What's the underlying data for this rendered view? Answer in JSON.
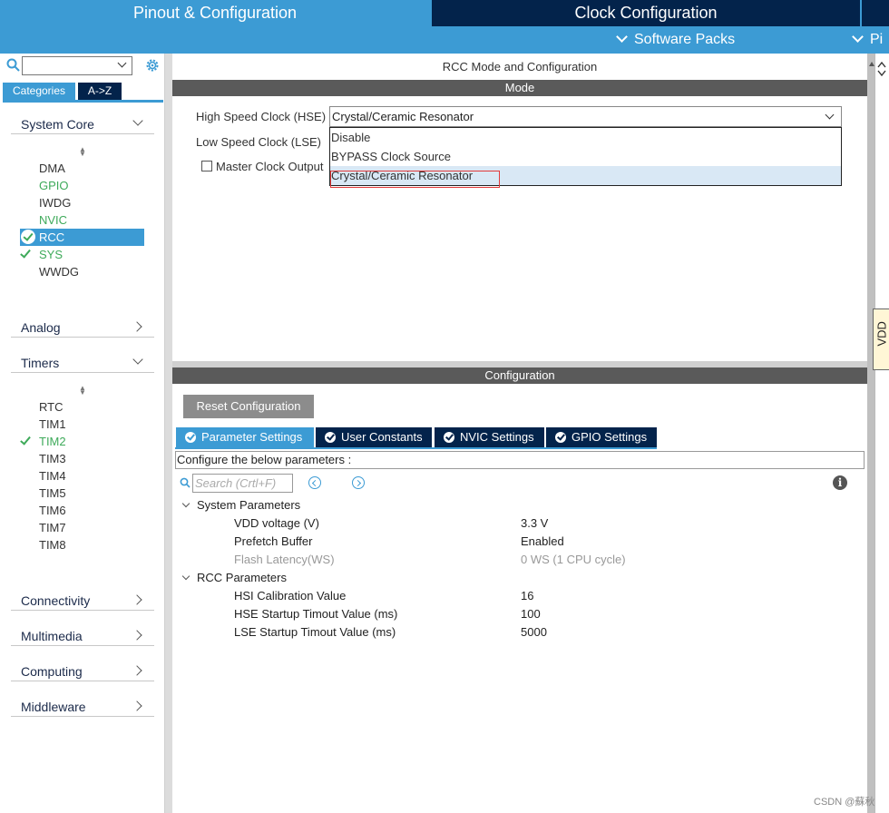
{
  "topbar": {
    "tab_pinout": "Pinout & Configuration",
    "tab_clock": "Clock Configuration",
    "tab_more": "Pi",
    "software_packs": "Software Packs",
    "more_menu": "Pi"
  },
  "sidebar": {
    "search_value": "",
    "tab_categories": "Categories",
    "tab_az": "A->Z",
    "system_core": {
      "label": "System Core",
      "items": [
        {
          "label": "DMA",
          "status": "none"
        },
        {
          "label": "GPIO",
          "status": "green"
        },
        {
          "label": "IWDG",
          "status": "none"
        },
        {
          "label": "NVIC",
          "status": "green"
        },
        {
          "label": "RCC",
          "status": "selected-checked"
        },
        {
          "label": "SYS",
          "status": "checked"
        },
        {
          "label": "WWDG",
          "status": "none"
        }
      ]
    },
    "analog": "Analog",
    "timers": {
      "label": "Timers",
      "items": [
        {
          "label": "RTC",
          "status": "none"
        },
        {
          "label": "TIM1",
          "status": "none"
        },
        {
          "label": "TIM2",
          "status": "checked"
        },
        {
          "label": "TIM3",
          "status": "none"
        },
        {
          "label": "TIM4",
          "status": "none"
        },
        {
          "label": "TIM5",
          "status": "none"
        },
        {
          "label": "TIM6",
          "status": "none"
        },
        {
          "label": "TIM7",
          "status": "none"
        },
        {
          "label": "TIM8",
          "status": "none"
        }
      ]
    },
    "connectivity": "Connectivity",
    "multimedia": "Multimedia",
    "computing": "Computing",
    "middleware": "Middleware"
  },
  "mode": {
    "title": "RCC Mode and Configuration",
    "bar": "Mode",
    "hse_label": "High Speed Clock (HSE)",
    "hse_value": "Crystal/Ceramic Resonator",
    "lse_label": "Low Speed Clock (LSE)",
    "mco_label": "Master Clock Output",
    "dropdown_options": [
      "Disable",
      "BYPASS Clock Source",
      "Crystal/Ceramic Resonator"
    ]
  },
  "config": {
    "bar": "Configuration",
    "reset_label": "Reset Configuration",
    "tabs": [
      "Parameter Settings",
      "User Constants",
      "NVIC Settings",
      "GPIO Settings"
    ],
    "configure_text": "Configure the below parameters :",
    "search_placeholder": "Search (Crtl+F)",
    "groups": [
      {
        "name": "System Parameters",
        "params": [
          {
            "name": "VDD voltage (V)",
            "value": "3.3 V",
            "disabled": false
          },
          {
            "name": "Prefetch Buffer",
            "value": "Enabled",
            "disabled": false
          },
          {
            "name": "Flash Latency(WS)",
            "value": "0 WS (1 CPU cycle)",
            "disabled": true
          }
        ]
      },
      {
        "name": "RCC Parameters",
        "params": [
          {
            "name": "HSI Calibration Value",
            "value": "16",
            "disabled": false
          },
          {
            "name": "HSE Startup Timout Value (ms)",
            "value": "100",
            "disabled": false
          },
          {
            "name": "LSE Startup Timout Value (ms)",
            "value": "5000",
            "disabled": false
          }
        ]
      }
    ]
  },
  "side_label": "VDD",
  "watermark": "CSDN @蘇秋",
  "colors": {
    "accent": "#3c9bd4",
    "navy": "#03234b",
    "green": "#3eaa5a",
    "highlight_border": "#e23a3a"
  }
}
